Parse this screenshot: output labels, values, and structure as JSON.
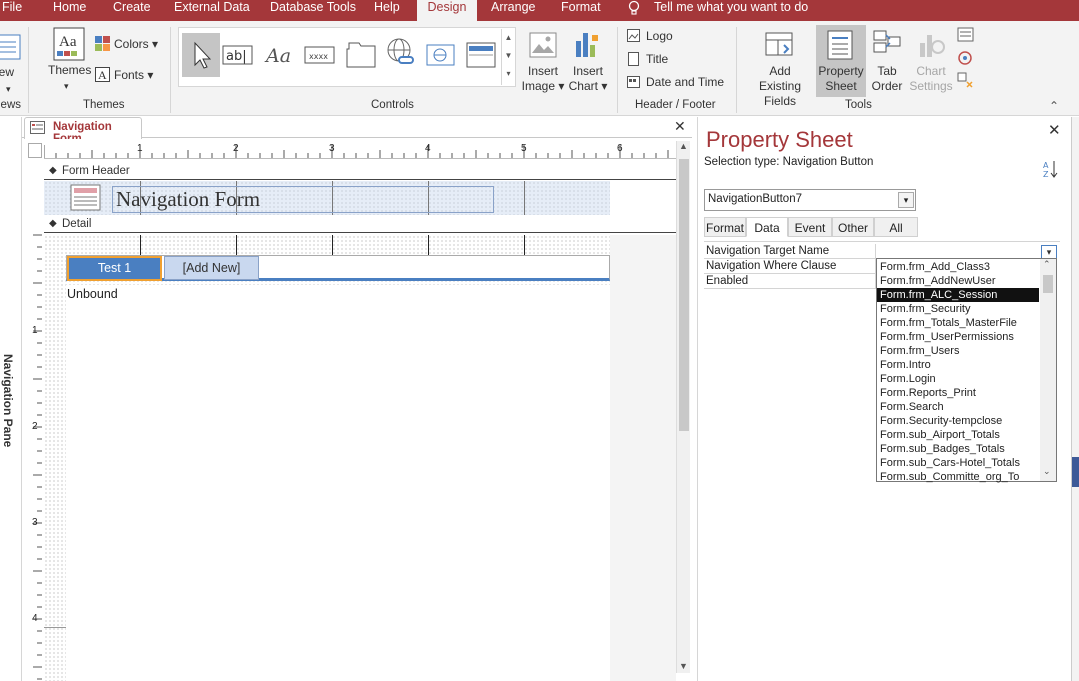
{
  "ribbon_tabs": [
    "File",
    "Home",
    "Create",
    "External Data",
    "Database Tools",
    "Help",
    "Design",
    "Arrange",
    "Format"
  ],
  "active_tab": "Design",
  "tell_me": "Tell me what you want to do",
  "views": {
    "label": "View",
    "group": "iews"
  },
  "themes": {
    "themes_label": "Themes",
    "colors_label": "Colors",
    "fonts_label": "Fonts",
    "group": "Themes"
  },
  "controls": {
    "group": "Controls",
    "insert_image": "Insert Image",
    "insert_chart": "Insert Chart"
  },
  "header_footer": {
    "logo": "Logo",
    "title": "Title",
    "date_time": "Date and Time",
    "group": "Header / Footer"
  },
  "tools": {
    "add_existing_fields": "Add Existing Fields",
    "property_sheet": "Property Sheet",
    "tab_order": "Tab Order",
    "chart_settings": "Chart Settings",
    "group": "Tools"
  },
  "nav_pane_label": "Navigation Pane",
  "document": {
    "tab_title": "Navigation Form",
    "form_header_label": "Form Header",
    "form_title": "Navigation Form",
    "detail_label": "Detail",
    "nav_button_1": "Test 1",
    "nav_button_add": "[Add New]",
    "unbound_label": "Unbound",
    "ruler_numbers": [
      "1",
      "2",
      "3",
      "4",
      "5",
      "6"
    ],
    "vruler_numbers": [
      "1",
      "2",
      "3",
      "4"
    ]
  },
  "property_sheet": {
    "title": "Property Sheet",
    "selection_type_label": "Selection type:",
    "selection_type_value": "Navigation Button",
    "selected_object": "NavigationButton7",
    "tabs": [
      "Format",
      "Data",
      "Event",
      "Other",
      "All"
    ],
    "active_tab": "Data",
    "rows": [
      "Navigation Target Name",
      "Navigation Where Clause",
      "Enabled"
    ],
    "dropdown_items": [
      "Form.frm_Add_Class3",
      "Form.frm_AddNewUser",
      "Form.frm_ALC_Session",
      "Form.frm_Security",
      "Form.frm_Totals_MasterFile",
      "Form.frm_UserPermissions",
      "Form.frm_Users",
      "Form.Intro",
      "Form.Login",
      "Form.Reports_Print",
      "Form.Search",
      "Form.Security-tempclose",
      "Form.sub_Airport_Totals",
      "Form.sub_Badges_Totals",
      "Form.sub_Cars-Hotel_Totals",
      "Form.sub_Committe_org_To"
    ],
    "selected_item": "Form.frm_ALC_Session"
  },
  "colors": {
    "accent": "#a4373a",
    "ribbon_bg": "#f3f3f3",
    "selected_tool": "#c5c5c5",
    "nav_blue": "#4a7fc1",
    "nav_outline": "#f0a030",
    "header_band": "#c9d8ef"
  }
}
